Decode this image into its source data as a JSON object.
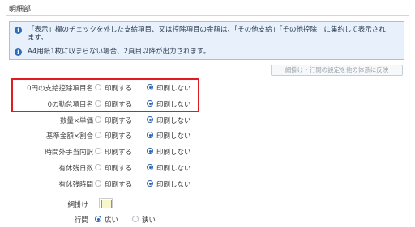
{
  "section": {
    "title": "明細部"
  },
  "notice": {
    "line1": "「表示」欄のチェックを外した支給項目、又は控除項目の金額は、「その他支給」「その他控除」に集約して表示され",
    "line1b": "ます。",
    "line2": "A4用紙1枚に収まらない場合、2頁目以降が出力されます。"
  },
  "reflect_button": {
    "label": "網掛け・行間の設定を他の体系に反映"
  },
  "print_on": "印刷する",
  "print_off": "印刷しない",
  "rows": [
    {
      "label": "0円の支給控除項目名",
      "selected": "off"
    },
    {
      "label": "0の勤怠項目名",
      "selected": "off"
    },
    {
      "label": "数量×単価",
      "selected": "off"
    },
    {
      "label": "基準金額×割合",
      "selected": "off"
    },
    {
      "label": "時間外手当内訳",
      "selected": "off"
    },
    {
      "label": "有休残日数",
      "selected": "off"
    },
    {
      "label": "有休残時間",
      "selected": "off"
    }
  ],
  "shading": {
    "label": "網掛け",
    "color": "#f7f7c8"
  },
  "line_spacing": {
    "label": "行間",
    "wide": "広い",
    "narrow": "狭い",
    "selected": "wide"
  },
  "colors": {
    "accent": "#2e64b0",
    "highlight": "#e01b24",
    "notice_bg": "#e8f1fb"
  }
}
